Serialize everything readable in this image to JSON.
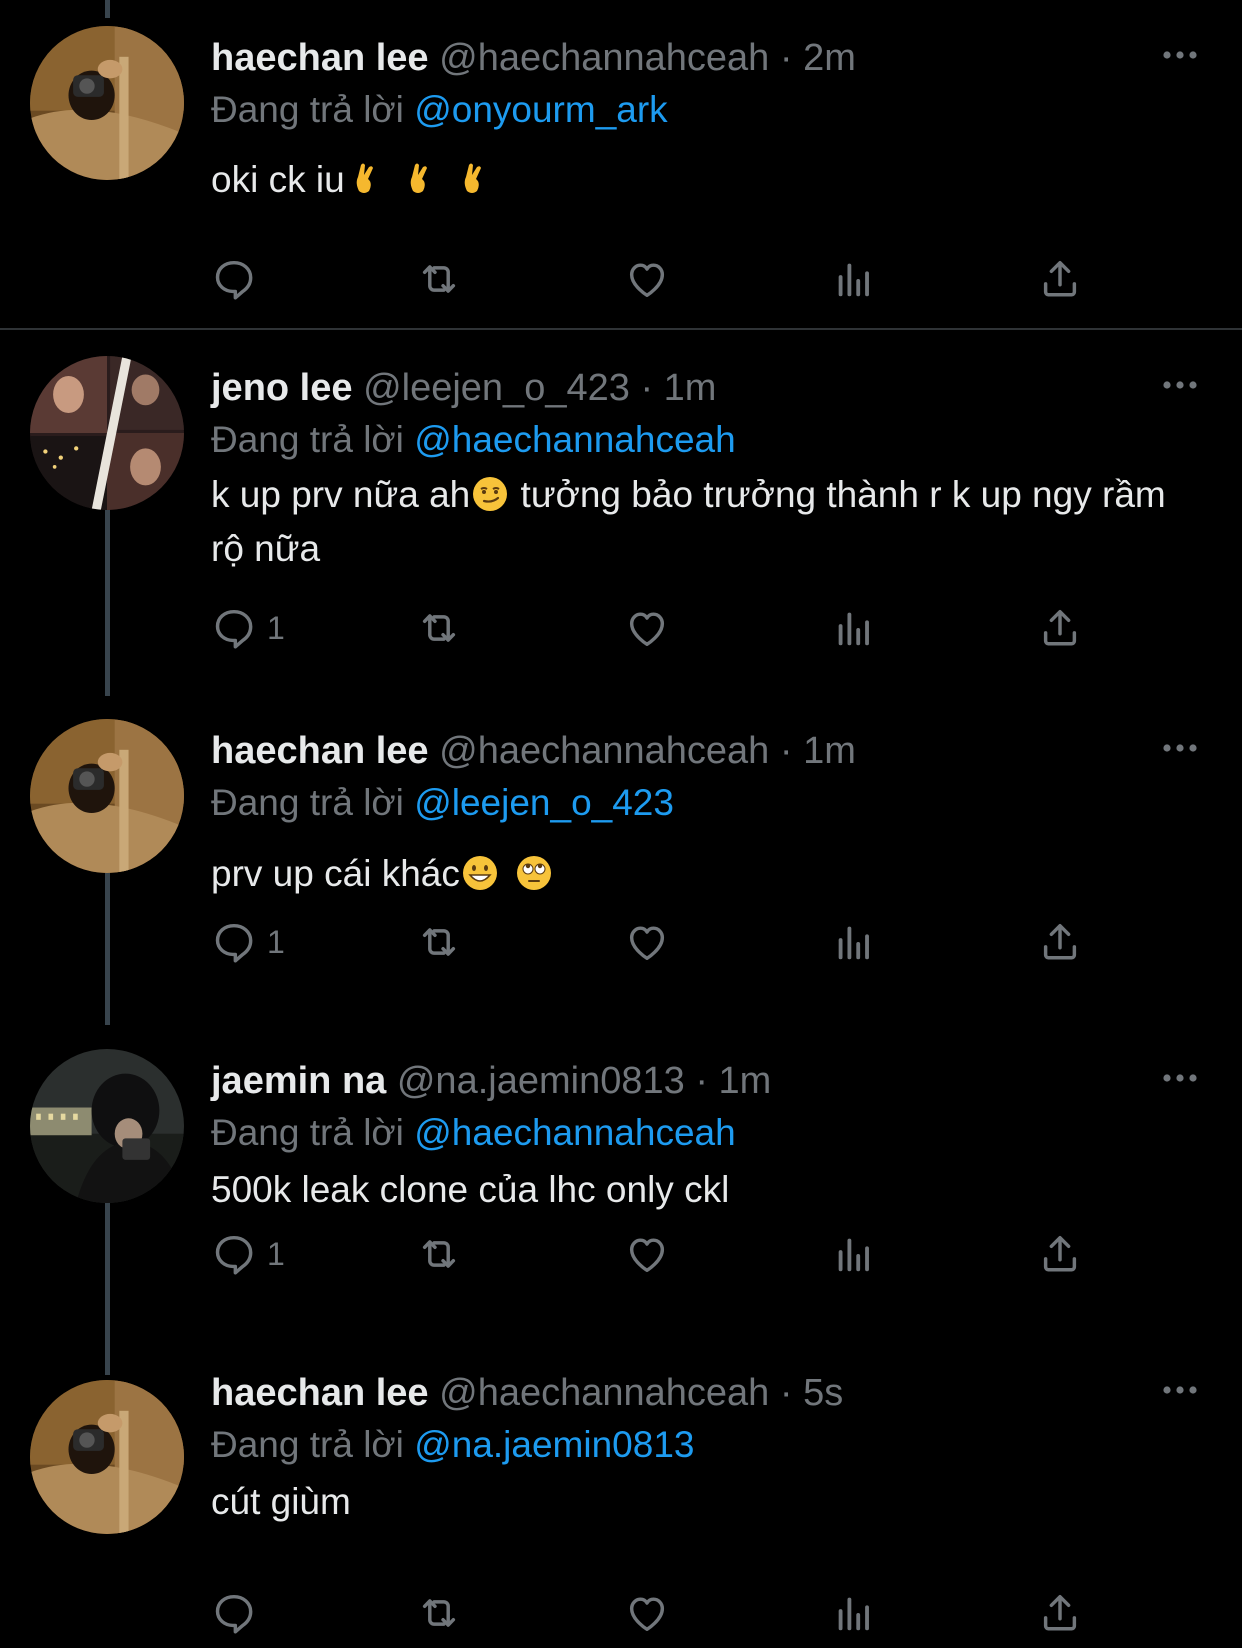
{
  "reply_prefix": "Đang trả lời",
  "tweets": [
    {
      "name": "haechan lee",
      "handle": "@haechannahceah",
      "time": "2m",
      "reply_to": "@onyourm_ark",
      "text": "oki ck iu",
      "emojis": [
        "crossed-fingers",
        "crossed-fingers",
        "crossed-fingers"
      ],
      "reply_count": ""
    },
    {
      "name": "jeno lee",
      "handle": "@leejen_o_423",
      "time": "1m",
      "reply_to": "@haechannahceah",
      "text_part1": "k up prv nữa ah",
      "emoji1": "smirking-face",
      "text_part2": " tưởng bảo trưởng thành r k up ngy rầm rộ nữa",
      "reply_count": "1"
    },
    {
      "name": "haechan lee",
      "handle": "@haechannahceah",
      "time": "1m",
      "reply_to": "@leejen_o_423",
      "text": "prv up cái khác",
      "emojis": [
        "grinning-face",
        "rolling-eyes-face"
      ],
      "reply_count": "1"
    },
    {
      "name": "jaemin na",
      "handle": "@na.jaemin0813",
      "time": "1m",
      "reply_to": "@haechannahceah",
      "text": "500k leak clone của lhc only ckl",
      "reply_count": "1"
    },
    {
      "name": "haechan lee",
      "handle": "@haechannahceah",
      "time": "5s",
      "reply_to": "@na.jaemin0813",
      "text": "cút giùm",
      "reply_count": ""
    }
  ],
  "colors": {
    "background": "#000000",
    "accent": "#1d9bf0",
    "muted": "#71767b",
    "text": "#e7e9ea"
  },
  "icons": [
    "reply-icon",
    "retweet-icon",
    "like-icon",
    "views-icon",
    "share-icon",
    "more-icon"
  ]
}
